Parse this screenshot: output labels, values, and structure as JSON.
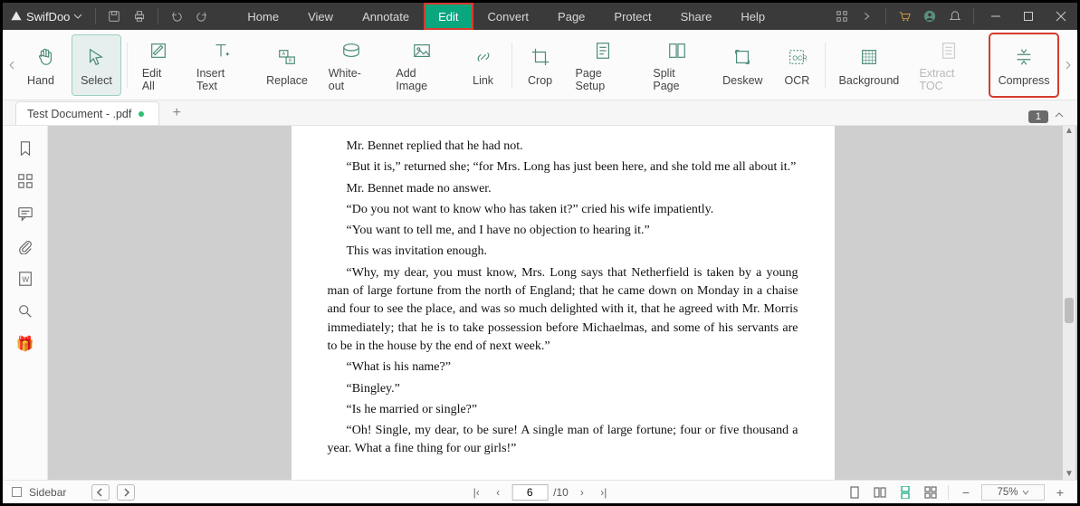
{
  "app": {
    "name": "SwifDoo"
  },
  "menu": {
    "tabs": [
      "Home",
      "View",
      "Annotate",
      "Edit",
      "Convert",
      "Page",
      "Protect",
      "Share",
      "Help"
    ],
    "active_index": 3
  },
  "ribbon": {
    "items": [
      {
        "label": "Hand"
      },
      {
        "label": "Select"
      },
      {
        "label": "Edit All"
      },
      {
        "label": "Insert Text"
      },
      {
        "label": "Replace"
      },
      {
        "label": "White-out"
      },
      {
        "label": "Add Image"
      },
      {
        "label": "Link"
      },
      {
        "label": "Crop"
      },
      {
        "label": "Page Setup"
      },
      {
        "label": "Split Page"
      },
      {
        "label": "Deskew"
      },
      {
        "label": "OCR"
      },
      {
        "label": "Background"
      },
      {
        "label": "Extract TOC"
      },
      {
        "label": "Compress"
      }
    ]
  },
  "doctab": {
    "title": "Test Document - .pdf"
  },
  "page_indicator": "1",
  "document": {
    "p0": "Mr. Bennet replied that he had not.",
    "p1": "“But it is,” returned she; “for Mrs. Long has just been here, and she told me all about it.”",
    "p2": "Mr. Bennet made no answer.",
    "p3": "“Do you not want to know who has taken it?” cried his wife impatiently.",
    "p4": "“You want to tell me, and I have no objection to hearing it.”",
    "p5": "This was invitation enough.",
    "p6": "“Why, my dear, you must know, Mrs. Long says that Netherfield is taken by a young man of large fortune from the north of England; that he came down on Monday in a chaise and four to see the place, and was so much delighted with it, that he agreed with Mr. Morris immediately; that he is to take possession before Michaelmas, and some of his servants are to be in the house by the end of next week.”",
    "p7": "“What is his name?”",
    "p8": "“Bingley.”",
    "p9": "“Is he married or single?”",
    "p10": "“Oh! Single, my dear, to be sure! A single man of large fortune; four or five thousand a year. What a fine thing for our girls!”"
  },
  "status": {
    "sidebar_label": "Sidebar",
    "current_page": "6",
    "total_pages": "/10",
    "zoom": "75%"
  }
}
